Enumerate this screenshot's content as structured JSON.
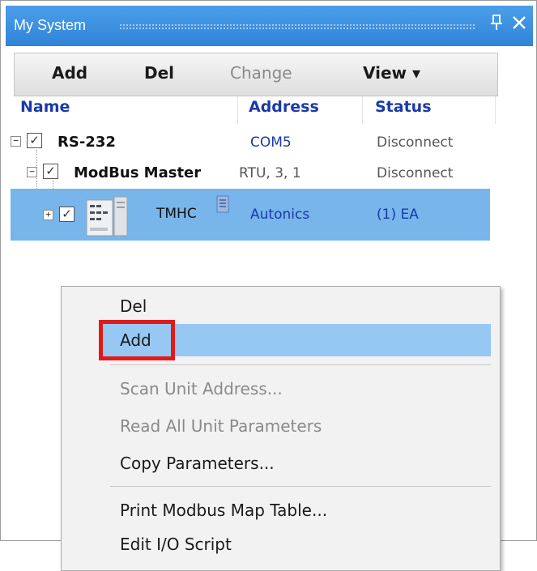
{
  "panel": {
    "title": "My System",
    "pin_glyph": "📌",
    "close_glyph": "✕"
  },
  "toolbar": {
    "add_label": "Add",
    "del_label": "Del",
    "change_label": "Change",
    "view_label": "View ▾"
  },
  "columns": {
    "name": "Name",
    "address": "Address",
    "status": "Status"
  },
  "tree": {
    "rows": [
      {
        "name": "RS-232",
        "address": "COM5",
        "status": "Disconnect"
      },
      {
        "name": "ModBus Master",
        "address": "RTU, 3, 1",
        "status": "Disconnect"
      },
      {
        "name": "TMHC",
        "address": "Autonics",
        "status": "(1) EA"
      }
    ]
  },
  "context_menu": {
    "items": [
      {
        "label": "Del",
        "enabled": true
      },
      {
        "label": "Add",
        "enabled": true,
        "highlighted": true
      },
      {
        "label": "Scan Unit Address...",
        "enabled": false
      },
      {
        "label": "Read All Unit Parameters",
        "enabled": false
      },
      {
        "label": "Copy Parameters...",
        "enabled": true
      },
      {
        "label": "Print Modbus Map Table...",
        "enabled": true
      },
      {
        "label": "Edit I/O Script",
        "enabled": true
      }
    ]
  },
  "colors": {
    "title_bar": "#3a8fe0",
    "selection": "#77b5ea",
    "menu_highlight": "#97c8f4",
    "callout_red": "#e01a1a",
    "column_header": "#1a3aa8"
  },
  "icons": {
    "pin": "pin-icon",
    "close": "close-icon",
    "expand": "expand-icon",
    "collapse": "collapse-icon",
    "checkbox": "checkbox-checked-icon",
    "device": "tmhc-device-icon",
    "document": "document-icon"
  }
}
